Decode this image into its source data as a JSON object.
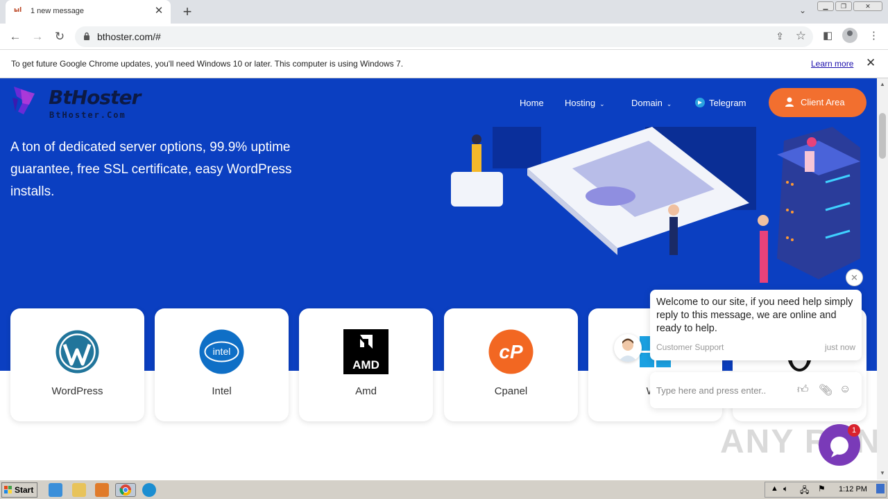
{
  "browser": {
    "tab_title": "1 new message",
    "tab_favicon": "ыl",
    "url": "bthoster.com/#"
  },
  "infobar": {
    "message": "To get future Google Chrome updates, you'll need Windows 10 or later. This computer is using Windows 7.",
    "learn_more": "Learn more"
  },
  "site": {
    "logo_name": "BtHoster",
    "logo_sub": "BtHoster.Com",
    "nav": {
      "home": "Home",
      "hosting": "Hosting",
      "domain": "Domain",
      "telegram": "Telegram",
      "client_area": "Client Area"
    },
    "tagline": "A ton of dedicated server options, 99.9% uptime guarantee, free SSL certificate, easy WordPress installs.",
    "cards": [
      {
        "label": "WordPress"
      },
      {
        "label": "Intel"
      },
      {
        "label": "Amd"
      },
      {
        "label": "Cpanel"
      },
      {
        "label": "Win"
      }
    ],
    "brand_colors": {
      "hero": "#0b3fc1",
      "accent": "#f26f2f"
    }
  },
  "chat": {
    "message": "Welcome to our site, if you need help simply reply to this message, we are online and ready to help.",
    "from": "Customer Support",
    "time": "just now",
    "input_placeholder": "Type here and press enter..",
    "badge": "1"
  },
  "watermark": "ANY RUN",
  "taskbar": {
    "start": "Start",
    "clock": "1:12 PM"
  }
}
